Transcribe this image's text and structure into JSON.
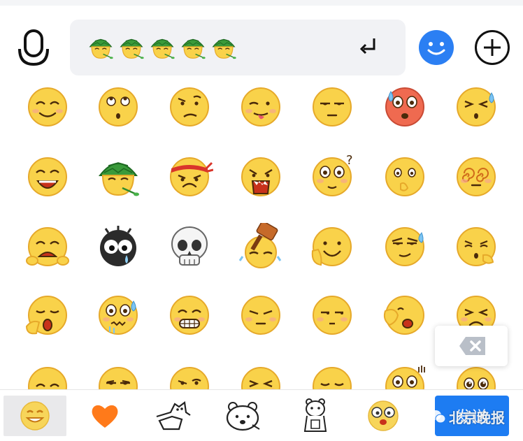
{
  "input": {
    "typed_emojis": [
      "turtle",
      "turtle",
      "turtle",
      "turtle",
      "turtle"
    ]
  },
  "emoji_grid": {
    "rows": [
      [
        "smile",
        "rolling-eyes",
        "puzzled",
        "tongue-out",
        "unamused",
        "shocked",
        "sweat-squint"
      ],
      [
        "laughing",
        "turtle",
        "angry-headband",
        "screaming",
        "question",
        "hand-on-mouth",
        "dizzy"
      ],
      [
        "crying-hug",
        "black-blob",
        "skull",
        "hammer",
        "facepalm-smile",
        "smirk-sweat",
        "thinking"
      ],
      [
        "yawn",
        "shy-sweat",
        "grin-teeth",
        "pouting",
        "sideglance",
        "face-covering",
        "squint"
      ],
      [
        "upset",
        "sad",
        "sneer",
        "squint-laugh",
        "giggle",
        "shocked-lines",
        "teary-eyed"
      ]
    ]
  },
  "tabs": [
    "emoji-tab",
    "favorites-tab",
    "sticker-cat",
    "sticker-bear",
    "sticker-polar-bear",
    "sticker-emoji"
  ],
  "send_label": "发送",
  "watermark_text": "北京晚报"
}
